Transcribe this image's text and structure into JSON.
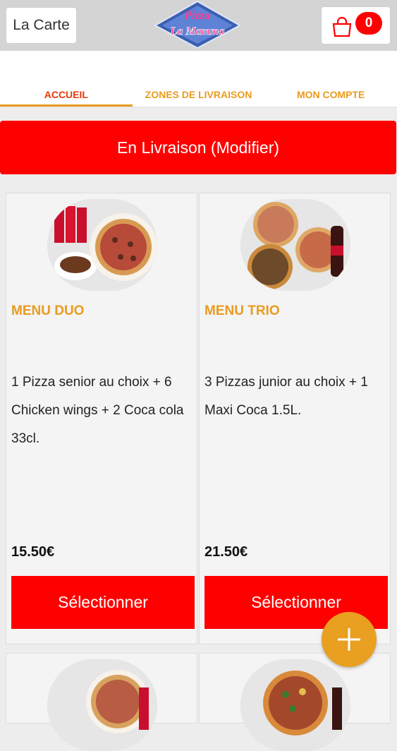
{
  "header": {
    "menu_label": "La Carte",
    "logo_text_top": "Pizza",
    "logo_text_bottom": "La Mamma",
    "cart_count": "0"
  },
  "tabs": [
    {
      "label": "ACCUEIL",
      "active": true
    },
    {
      "label": "ZONES DE LIVRAISON",
      "active": false
    },
    {
      "label": "MON COMPTE",
      "active": false
    }
  ],
  "delivery_label": "En Livraison (Modifier)",
  "products": [
    {
      "title": "MENU DUO",
      "description": "1 Pizza senior au choix  + 6 Chicken wings  + 2 Coca cola 33cl.",
      "price": "15.50€",
      "button": "Sélectionner"
    },
    {
      "title": "MENU TRIO",
      "description": "3 Pizzas junior au choix  + 1 Maxi Coca 1.5L.",
      "price": "21.50€",
      "button": "Sélectionner"
    }
  ],
  "colors": {
    "accent": "#fe0000",
    "brand_orange": "#e99b20",
    "active_tab": "#e8380d"
  },
  "fab_icon": "plus-icon"
}
